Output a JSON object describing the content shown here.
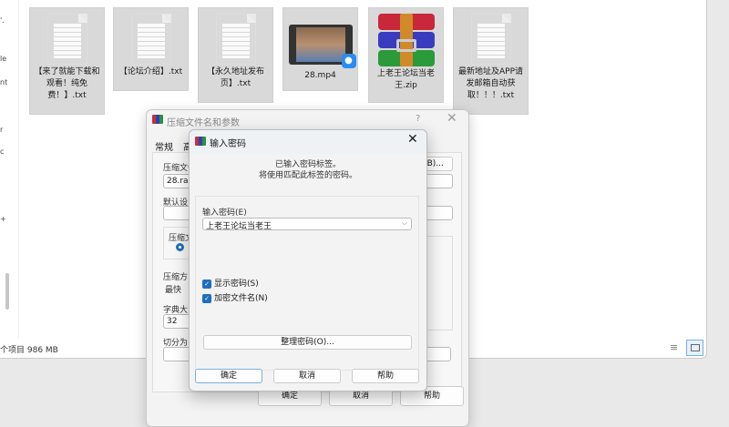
{
  "explorer": {
    "files": [
      {
        "name": "【来了就能下载和观看！纯免费！】.txt",
        "type": "txt"
      },
      {
        "name": "【论坛介绍】.txt",
        "type": "txt"
      },
      {
        "name": "【永久地址发布页】.txt",
        "type": "txt"
      },
      {
        "name": "28.mp4",
        "type": "video"
      },
      {
        "name": "上老王论坛当老王.zip",
        "type": "rar"
      },
      {
        "name": "最新地址及APP请发邮箱自动获取！！！.txt",
        "type": "txt"
      }
    ],
    "status": "个项目  986 MB",
    "sidebar_fragments": [
      "'.",
      "le",
      "nt",
      "r",
      "c",
      "+"
    ]
  },
  "archive_dialog": {
    "title": "压缩文件名和参数",
    "help": "?",
    "tabs": [
      "常规",
      "高"
    ],
    "archive_name_label": "压缩文件",
    "archive_name": "28.rar",
    "browse": "(B)...",
    "default_profile_label": "默认设",
    "format_label": "压缩文",
    "method_label": "压缩方",
    "method": "最快",
    "dict_label": "字典大",
    "dict": "32",
    "split_label": "切分为",
    "ok": "确定",
    "cancel": "取消",
    "helpbtn": "帮助"
  },
  "password_dialog": {
    "title": "输入密码",
    "info_line1": "已输入密码标签。",
    "info_line2": "将使用匹配此标签的密码。",
    "password_label": "输入密码(E)",
    "password_value": "上老王论坛当老王",
    "show_password": "显示密码(S)",
    "encrypt_names": "加密文件名(N)",
    "organize": "整理密码(O)...",
    "ok": "确定",
    "cancel": "取消",
    "help": "帮助"
  }
}
